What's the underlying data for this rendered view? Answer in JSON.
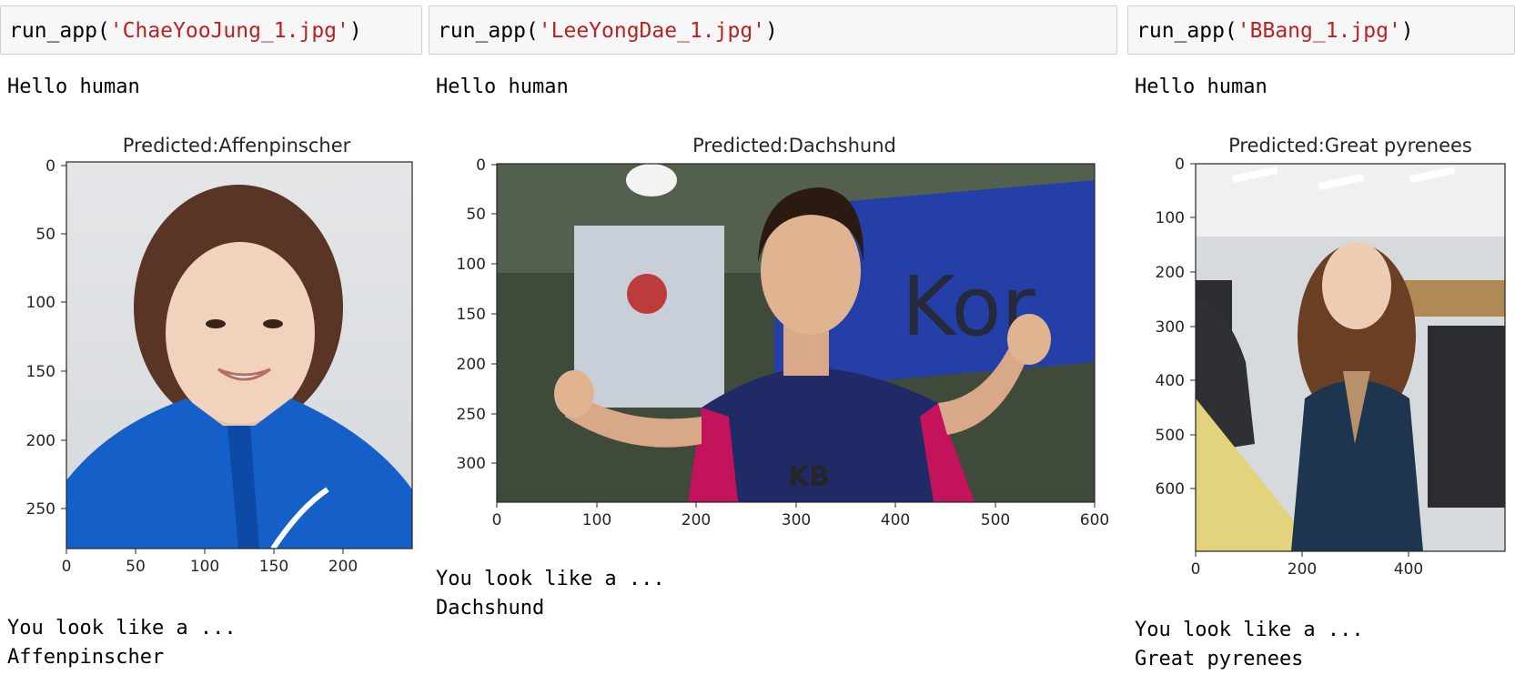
{
  "cells": [
    {
      "code_prefix": "run_app(",
      "code_arg": "'ChaeYooJung_1.jpg'",
      "code_suffix": ")",
      "greeting": "Hello human",
      "plot_title": "Predicted:Affenpinscher",
      "image_subject": "portrait-photo",
      "x_ticks": [
        "0",
        "50",
        "100",
        "150",
        "200"
      ],
      "y_ticks": [
        "0",
        "50",
        "100",
        "150",
        "200",
        "250"
      ],
      "xlim": [
        0,
        250
      ],
      "ylim": [
        0,
        281
      ],
      "result_line1": "You look like a ...",
      "result_line2": "Affenpinscher"
    },
    {
      "code_prefix": "run_app(",
      "code_arg": "'LeeYongDae_1.jpg'",
      "code_suffix": ")",
      "greeting": "Hello human",
      "plot_title": "Predicted:Dachshund",
      "image_subject": "athlete-photo",
      "x_ticks": [
        "0",
        "100",
        "200",
        "300",
        "400",
        "500",
        "600"
      ],
      "y_ticks": [
        "0",
        "50",
        "100",
        "150",
        "200",
        "250",
        "300"
      ],
      "xlim": [
        0,
        600
      ],
      "ylim": [
        0,
        338
      ],
      "result_line1": "You look like a ...",
      "result_line2": "Dachshund"
    },
    {
      "code_prefix": "run_app(",
      "code_arg": "'BBang_1.jpg'",
      "code_suffix": ")",
      "greeting": "Hello human",
      "plot_title": "Predicted:Great pyrenees",
      "image_subject": "classroom-photo",
      "x_ticks": [
        "0",
        "200",
        "400"
      ],
      "y_ticks": [
        "0",
        "100",
        "200",
        "300",
        "400",
        "500",
        "600"
      ],
      "xlim": [
        0,
        540
      ],
      "ylim": [
        0,
        680
      ],
      "result_line1": "You look like a ...",
      "result_line2": "Great pyrenees"
    }
  ],
  "colors": {
    "string": "#ba2121",
    "cell_bg": "#f7f7f7",
    "cell_border": "#cfcfcf"
  }
}
